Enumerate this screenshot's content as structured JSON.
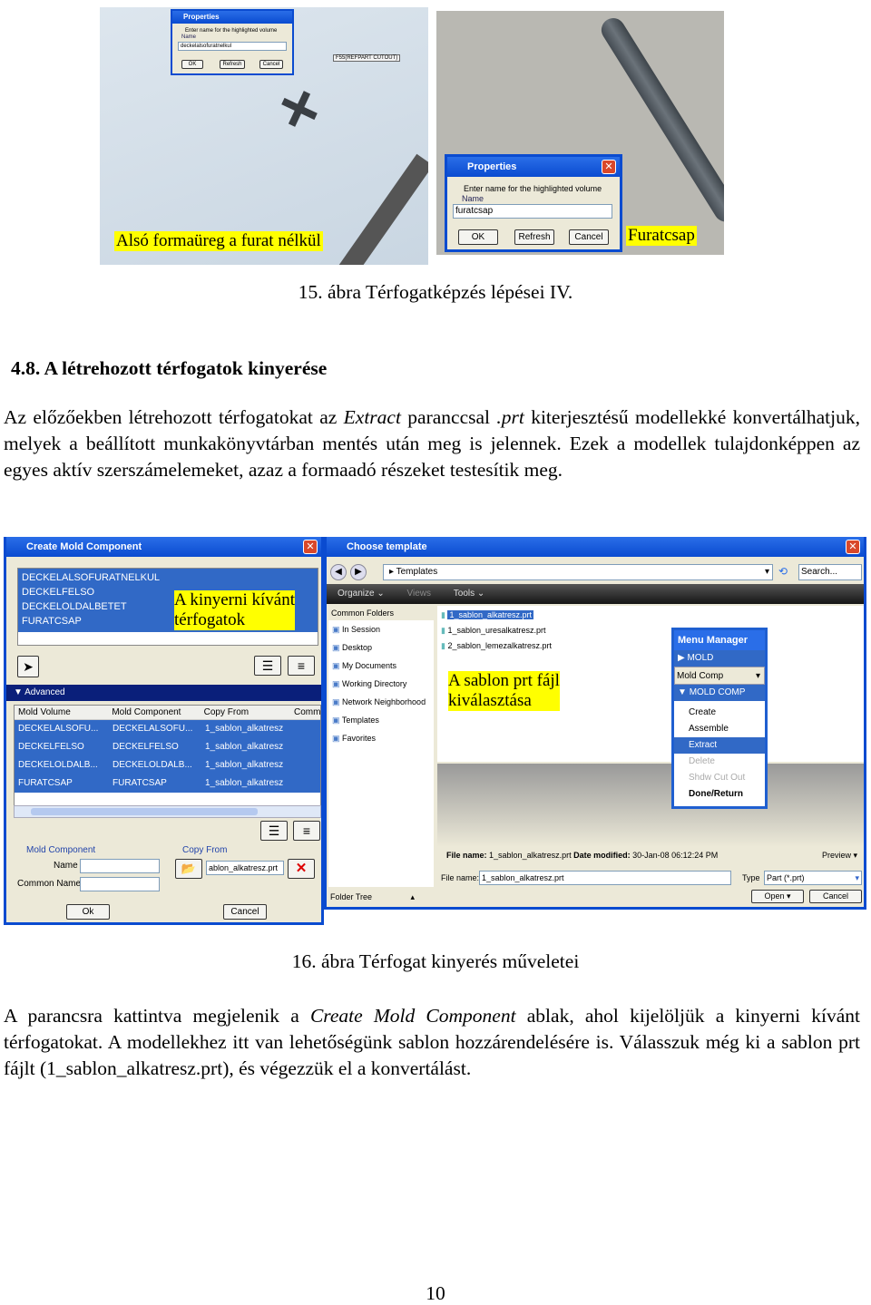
{
  "figure15": {
    "left": {
      "dialog_title": "Properties",
      "prompt": "Enter name for the highlighted volume",
      "name_label": "Name",
      "name_value": "deckelalsofuratnelkul",
      "ok": "OK",
      "refresh": "Refresh",
      "cancel": "Cancel",
      "tag": "F55(REFPART CUTOUT)",
      "annotation": "Alsó formaüreg a furat nélkül"
    },
    "right": {
      "dialog_title": "Properties",
      "prompt": "Enter name for the highlighted volume",
      "name_label": "Name",
      "name_value": "furatcsap",
      "ok": "OK",
      "refresh": "Refresh",
      "cancel": "Cancel",
      "annotation": "Furatcsap"
    },
    "caption": "15. ábra Térfogatképzés lépései IV."
  },
  "section": {
    "heading": "4.8. A létrehozott térfogatok kinyerése",
    "paragraph1": [
      "Az előzőekben létrehozott térfogatokat az ",
      "Extract",
      " paranccsal ",
      ".prt",
      " kiterjesztésű modellekké konvertálhatjuk, melyek a beállított munkakönyvtárban mentés után meg is jelennek. Ezek a modellek tulajdonképpen az egyes aktív szerszámelemeket, azaz a formaadó részeket testesítik meg."
    ]
  },
  "figure16": {
    "create_dialog": {
      "title": "Create Mold Component",
      "volumes": [
        "DECKELALSOFURATNELKUL",
        "DECKELFELSO",
        "DECKELOLDALBETET",
        "FURATCSAP"
      ],
      "annotation": [
        "A kinyerni kívánt",
        "térfogatok"
      ],
      "advanced": "Advanced",
      "columns": [
        "Mold Volume",
        "Mold Component",
        "Copy From",
        "Comm"
      ],
      "rows": [
        [
          "DECKELALSOFU...",
          "DECKELALSOFU...",
          "1_sablon_alkatresz"
        ],
        [
          "DECKELFELSO",
          "DECKELFELSO",
          "1_sablon_alkatresz"
        ],
        [
          "DECKELOLDALB...",
          "DECKELOLDALB...",
          "1_sablon_alkatresz"
        ],
        [
          "FURATCSAP",
          "FURATCSAP",
          "1_sablon_alkatresz"
        ]
      ],
      "mold_component_label": "Mold Component",
      "name_label": "Name",
      "common_name_label": "Common Name",
      "copy_from_label": "Copy From",
      "copy_from_value": "ablon_alkatresz.prt",
      "ok": "Ok",
      "cancel": "Cancel"
    },
    "template_dialog": {
      "title": "Choose template",
      "path": "Templates",
      "search_placeholder": "Search...",
      "toolbar": [
        "Organize",
        "Views",
        "Tools"
      ],
      "folders_header": "Common Folders",
      "folders": [
        "In Session",
        "Desktop",
        "My Documents",
        "Working Directory",
        "Network Neighborhood",
        "Templates",
        "Favorites"
      ],
      "files": [
        "1_sablon_alkatresz.prt",
        "1_sablon_uresalkatresz.prt",
        "2_sablon_lemezalkatresz.prt"
      ],
      "annotation": [
        "A sablon prt fájl",
        "kiválasztása"
      ],
      "info_label": "File name:",
      "info_value": "1_sablon_alkatresz.prt",
      "date_label": "Date modified:",
      "date_value": "30-Jan-08 06:12:24 PM",
      "preview": "Preview",
      "file_name_label": "File name:",
      "file_name_value": "1_sablon_alkatresz.prt",
      "type_label": "Type",
      "type_value": "Part (*.prt)",
      "folder_tree": "Folder Tree",
      "open": "Open",
      "cancel": "Cancel"
    },
    "menu_manager": {
      "title": "Menu Manager",
      "mold": "MOLD",
      "mold_comp_select": "Mold Comp",
      "mold_comp": "MOLD COMP",
      "items": [
        "Create",
        "Assemble",
        "Extract",
        "Delete",
        "Shdw Cut Out",
        "Done/Return"
      ]
    },
    "caption": "16. ábra Térfogat kinyerés műveletei"
  },
  "paragraph2": [
    "A parancsra kattintva megjelenik a ",
    "Create Mold Component",
    " ablak, ahol kijelöljük a kinyerni kívánt térfogatokat. A modellekhez itt van lehetőségünk sablon hozzárendelésére is. Válasszuk még ki a sablon prt fájlt (1_sablon_alkatresz.prt), és végezzük el a konvertálást."
  ],
  "page_number": "10"
}
